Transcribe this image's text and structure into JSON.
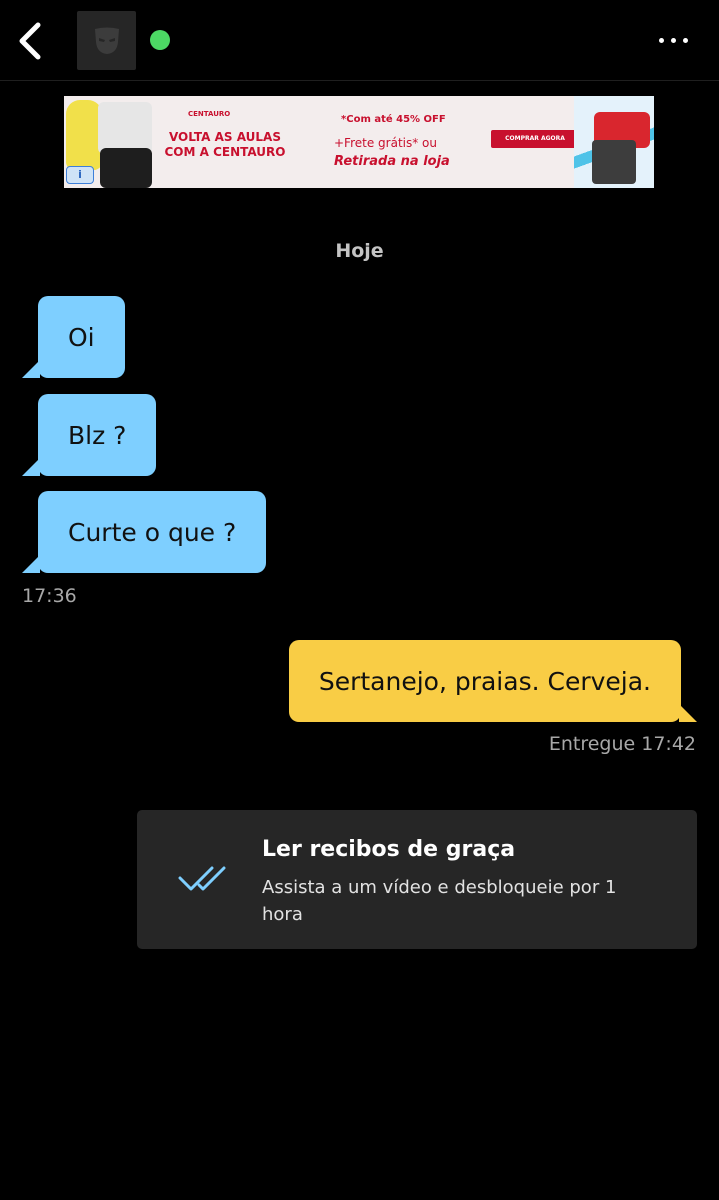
{
  "header": {
    "back_icon": "chevron-left-icon",
    "avatar_icon": "mask-icon",
    "online_status_color": "#4cd964",
    "more_icon": "more-horizontal-icon"
  },
  "ad": {
    "brand": "CENTAURO",
    "headline_line1": "VOLTA AS AULAS",
    "headline_line2": "COM A CENTAURO",
    "offer": "*Com até 45% OFF",
    "shipping": "+Frete grátis* ou",
    "pickup": "Retirada na loja",
    "cta": "COMPRAR AGORA",
    "info_label": "i"
  },
  "chat": {
    "date_label": "Hoje",
    "incoming": [
      {
        "text": "Oi"
      },
      {
        "text": "Blz ?"
      },
      {
        "text": "Curte o que ?"
      }
    ],
    "incoming_time": "17:36",
    "outgoing": [
      {
        "text": "Sertanejo, praias. Cerveja."
      }
    ],
    "outgoing_status": "Entregue 17:42"
  },
  "receipts_card": {
    "icon": "double-check-icon",
    "title": "Ler recibos de graça",
    "description": "Assista a um vídeo e desbloqueie por 1 hora"
  },
  "colors": {
    "incoming_bubble": "#7ecfff",
    "outgoing_bubble": "#f9cd45",
    "background": "#000000",
    "card": "#262626"
  }
}
